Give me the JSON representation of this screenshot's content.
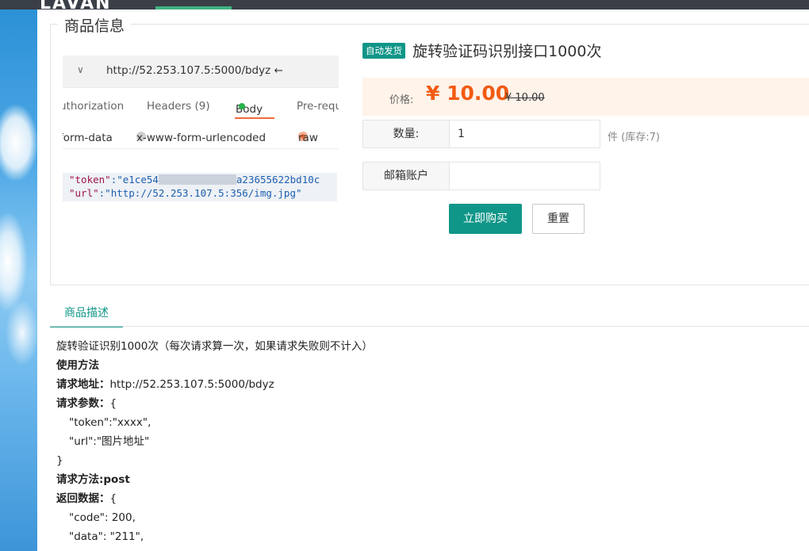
{
  "header": {
    "brand": "LAVAN"
  },
  "section": {
    "title": "商品信息"
  },
  "screenshot": {
    "url": "http://52.253.107.5:5000/bdyz ←",
    "tabs": [
      "uthorization",
      "Headers (9)",
      "Body",
      "Pre-requ"
    ],
    "radios": [
      "form-data",
      "x-www-form-urlencoded",
      "raw"
    ],
    "code_line1_key": "\"token\"",
    "code_line1_val_a": ":\"e1ce54",
    "code_line1_val_b": "a23655622bd10c",
    "code_line2_key": "\"url\"",
    "code_line2_val": ":\"http://52.253.107.5:356/img.jpg\""
  },
  "product": {
    "badge": "自动发货",
    "title": "旋转验证码识别接口1000次",
    "price_label": "价格:",
    "price": "¥ 10.00",
    "original_price": "¥ 10.00",
    "qty_label": "数量:",
    "qty_value": "1",
    "stock_note": "件 (库存:7)",
    "email_label": "邮箱账户",
    "email_value": "",
    "buy_label": "立即购买",
    "reset_label": "重置"
  },
  "description": {
    "tab": "商品描述",
    "lines": [
      "旋转验证识别1000次（每次请求算一次，如果请求失败则不计入）",
      "使用方法",
      "请求地址：",
      "http://52.253.107.5:5000/bdyz",
      "请求参数：",
      "{",
      "\"token\":\"xxxx\",",
      "\"url\":\"图片地址\"",
      "}",
      "请求方法:post",
      "返回数据：",
      "{",
      "\"code\": 200,",
      "\"data\": \"211\","
    ]
  }
}
